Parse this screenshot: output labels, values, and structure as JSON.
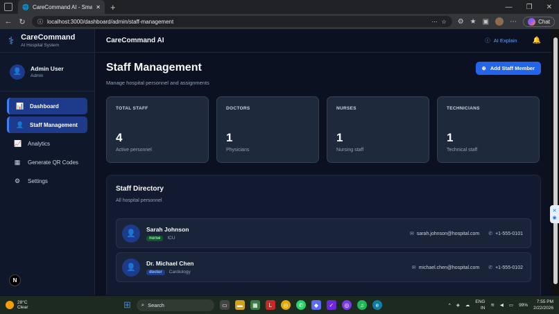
{
  "browser": {
    "tab_title": "CareCommand AI - Smart Digital H",
    "url": "localhost:3000/dashboard/admin/staff-management",
    "chat_label": "Chat"
  },
  "sidebar": {
    "brand_name": "CareCommand",
    "brand_sub": "AI Hospital System",
    "user_name": "Admin User",
    "user_role": "Admin",
    "items": [
      {
        "label": "Dashboard",
        "icon": "chart-icon"
      },
      {
        "label": "Staff Management",
        "icon": "user-icon"
      },
      {
        "label": "Analytics",
        "icon": "trend-icon"
      },
      {
        "label": "Generate QR Codes",
        "icon": "qr-icon"
      },
      {
        "label": "Settings",
        "icon": "gear-icon"
      }
    ],
    "n_badge": "N"
  },
  "header": {
    "title": "CareCommand AI",
    "ai_explain": "AI Explain"
  },
  "page": {
    "title": "Staff Management",
    "subtitle": "Manage hospital personnel and assignments",
    "add_button": "Add Staff Member"
  },
  "stats": [
    {
      "label": "TOTAL STAFF",
      "value": "4",
      "sub": "Active personnel"
    },
    {
      "label": "DOCTORS",
      "value": "1",
      "sub": "Physicians"
    },
    {
      "label": "NURSES",
      "value": "1",
      "sub": "Nursing staff"
    },
    {
      "label": "TECHNICIANS",
      "value": "1",
      "sub": "Technical staff"
    }
  ],
  "directory": {
    "title": "Staff Directory",
    "subtitle": "All hospital personnel",
    "rows": [
      {
        "name": "Sarah Johnson",
        "role": "nurse",
        "dept": "ICU",
        "email": "sarah.johnson@hospital.com",
        "phone": "+1-555-0101"
      },
      {
        "name": "Dr. Michael Chen",
        "role": "doctor",
        "dept": "Cardiology",
        "email": "michael.chen@hospital.com",
        "phone": "+1-555-0102"
      }
    ]
  },
  "taskbar": {
    "temp": "28°C",
    "weather": "Clear",
    "search": "Search",
    "lang": "ENG",
    "region": "IN",
    "battery": "99%",
    "time": "7:55 PM",
    "date": "2/22/2026"
  },
  "colors": {
    "accent": "#2563eb",
    "sidebar_active": "#1e3a8a",
    "nurse_badge": "#14532d",
    "doctor_badge": "#1e3a8a"
  }
}
